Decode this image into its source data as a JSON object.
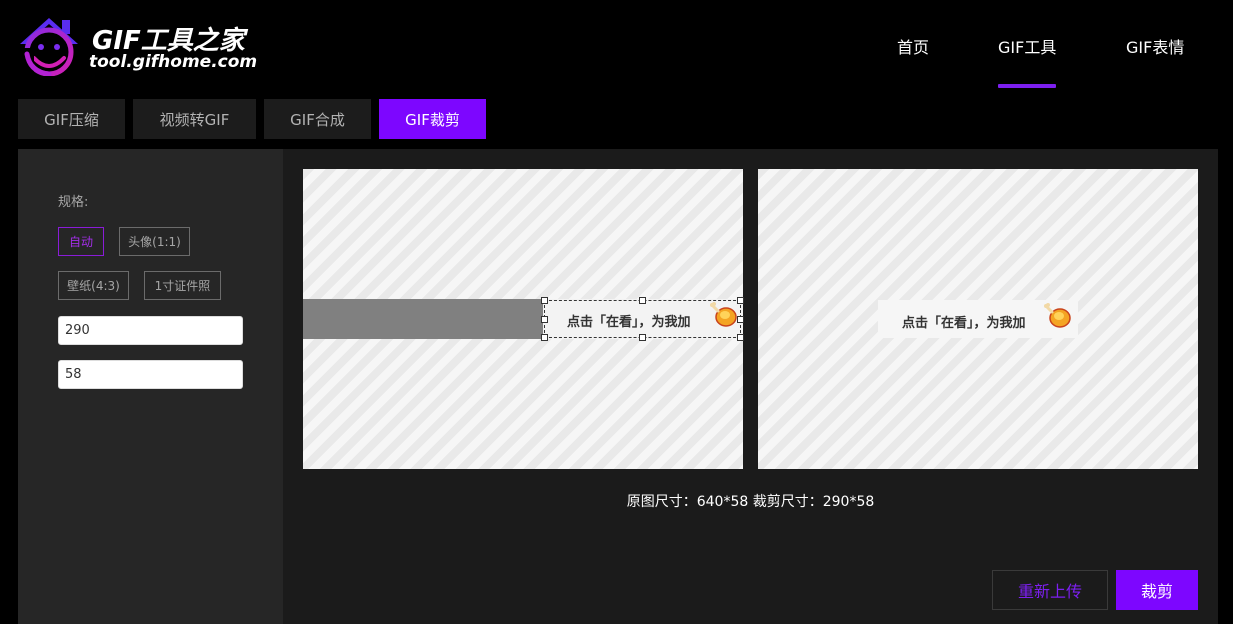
{
  "brand": {
    "title": "GIF工具之家",
    "url": "tool.gifhome.com",
    "accent": "#7d06ff"
  },
  "nav": {
    "items": [
      {
        "label": "首页"
      },
      {
        "label": "GIF工具",
        "active": true
      },
      {
        "label": "GIF表情"
      }
    ]
  },
  "tabs": [
    {
      "label": "GIF压缩"
    },
    {
      "label": "视频转GIF"
    },
    {
      "label": "GIF合成"
    },
    {
      "label": "GIF裁剪",
      "active": true
    }
  ],
  "sidebar": {
    "spec_label": "规格:",
    "presets": [
      {
        "label": "自动",
        "active": true
      },
      {
        "label": "头像(1:1)"
      },
      {
        "label": "壁纸(4:3)"
      },
      {
        "label": "1寸证件照"
      }
    ],
    "width_value": "290",
    "height_value": "58"
  },
  "preview": {
    "banner_text": "点击「在看」，为我加",
    "emoji_icon": "drumstick-icon"
  },
  "info": {
    "size_text": "原图尺寸：640*58 裁剪尺寸：290*58"
  },
  "actions": {
    "reupload_label": "重新上传",
    "crop_label": "裁剪"
  }
}
